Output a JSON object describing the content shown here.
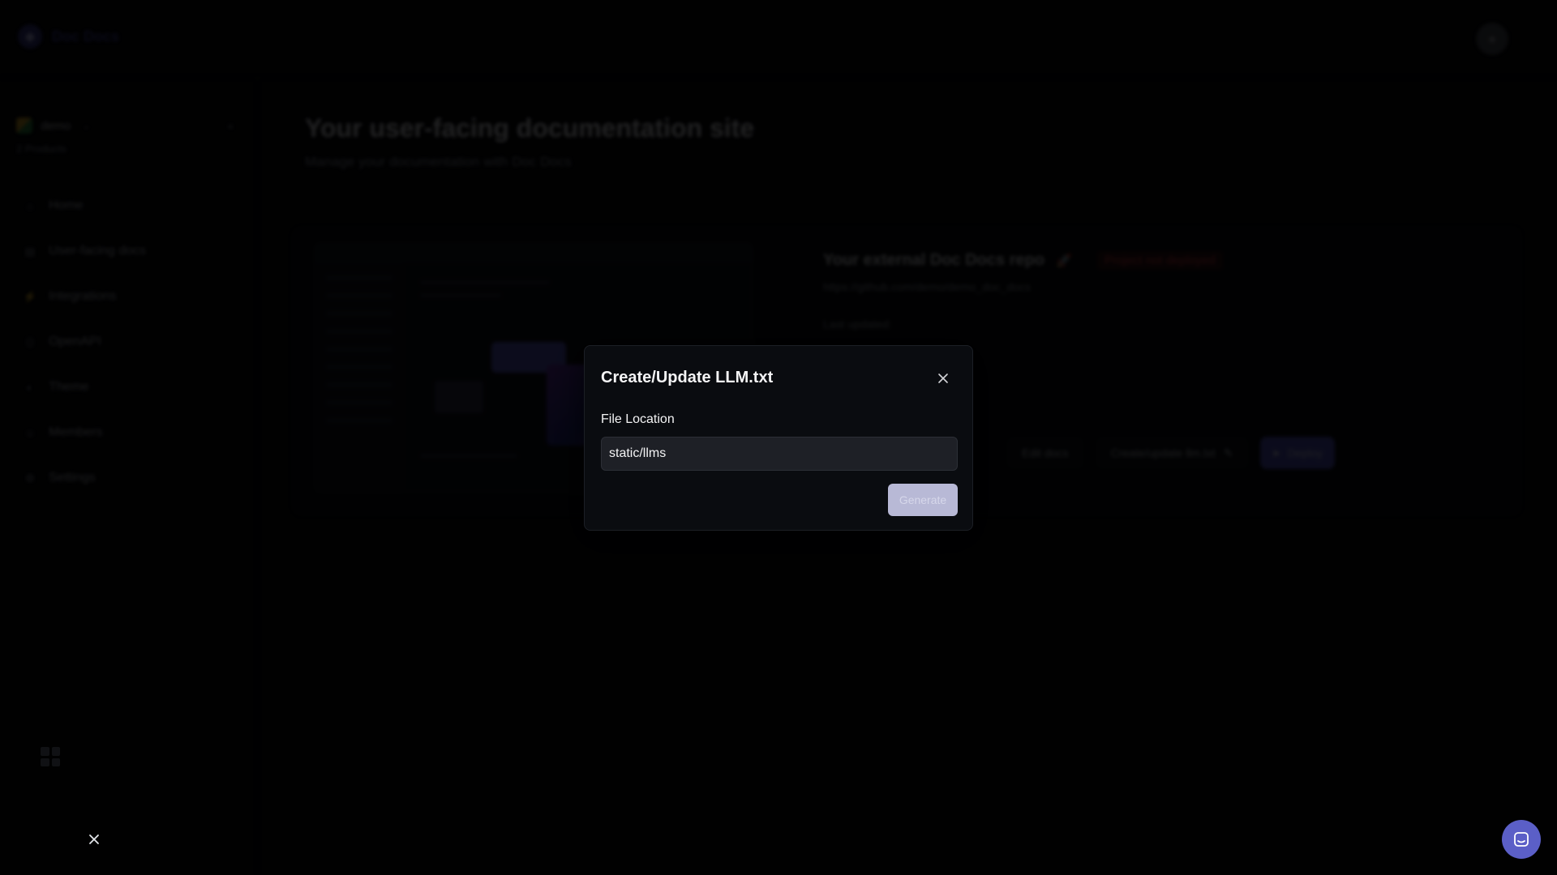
{
  "app": {
    "logo_text": "Doc Docs",
    "user_avatar_icon": "user-avatar-icon"
  },
  "sidebar": {
    "org_name": "demo",
    "org_sub": "2 Products",
    "items": [
      {
        "label": "Home",
        "icon": "home-icon"
      },
      {
        "label": "User-facing docs",
        "icon": "book-icon"
      },
      {
        "label": "Integrations",
        "icon": "plug-icon"
      },
      {
        "label": "OpenAPI",
        "icon": "code-icon"
      },
      {
        "label": "Theme",
        "icon": "palette-icon"
      },
      {
        "label": "Members",
        "icon": "users-icon"
      },
      {
        "label": "Settings",
        "icon": "gear-icon"
      }
    ]
  },
  "main": {
    "title": "Your user-facing documentation site",
    "subtitle": "Manage your documentation with Doc Docs",
    "repo": {
      "title": "Your external Doc Docs repo",
      "badge": "Project not deployed",
      "url": "https://github.com/demo/demo_doc_docs",
      "last_updated": "Last updated:",
      "actions": [
        "Edit docs",
        "Create/update llm.txt"
      ],
      "primary_action": "Deploy"
    }
  },
  "modal": {
    "title": "Create/Update LLM.txt",
    "field_label": "File Location",
    "field_value": "static/llms",
    "submit_label": "Generate"
  },
  "colors": {
    "accent": "#5b5fc7",
    "error": "#ef4444",
    "modal_bg": "#0a0c10",
    "input_bg": "#1e2026",
    "submit_disabled_bg": "#b8b9d6"
  }
}
